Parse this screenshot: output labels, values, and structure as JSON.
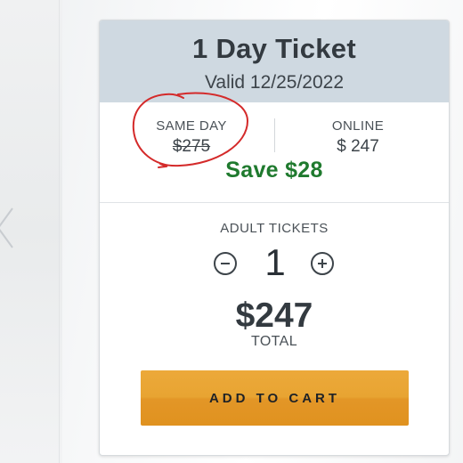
{
  "ticket": {
    "title": "1 Day Ticket",
    "valid": "Valid 12/25/2022"
  },
  "pricing": {
    "same_day_label": "SAME DAY",
    "same_day_price": "$275",
    "online_label": "ONLINE",
    "online_price": "$ 247",
    "save_text": "Save $28"
  },
  "quantity": {
    "label": "ADULT TICKETS",
    "value": "1"
  },
  "total": {
    "amount": "$247",
    "label": "TOTAL"
  },
  "actions": {
    "add_to_cart": "ADD TO CART"
  },
  "colors": {
    "header_bg": "#cfd9e1",
    "save_green": "#1f7a2e",
    "cart_orange": "#e8a432",
    "annotation_red": "#d42a2a"
  },
  "icons": {
    "prev": "chevron-left-icon",
    "minus": "minus-circle-icon",
    "plus": "plus-circle-icon"
  }
}
